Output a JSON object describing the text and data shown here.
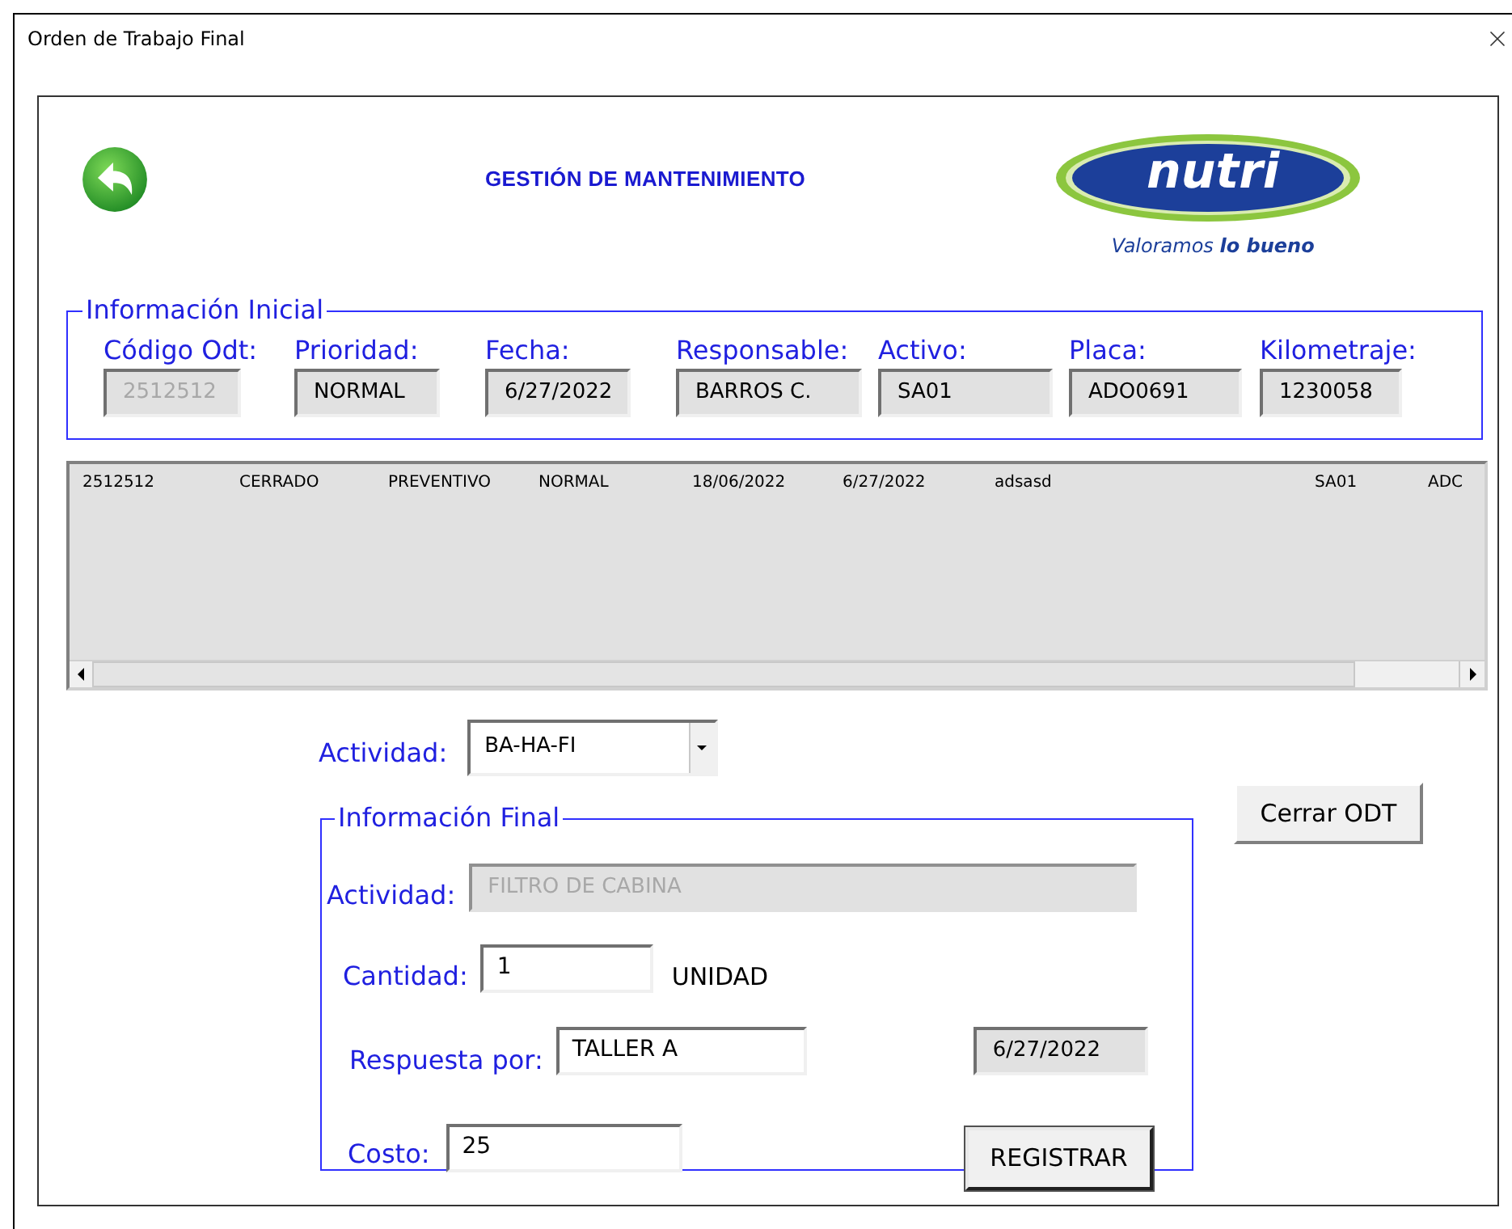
{
  "window": {
    "title": "Orden de Trabajo Final"
  },
  "header": {
    "title": "GESTIÓN DE MANTENIMIENTO",
    "logo": {
      "brand": "nutri",
      "tagline": "Valoramos **lo bueno**"
    }
  },
  "initial_info": {
    "title": "Información Inicial",
    "fields": [
      {
        "label": "Código Odt:",
        "value": "2512512",
        "disabled": true
      },
      {
        "label": "Prioridad:",
        "value": "NORMAL",
        "disabled": false
      },
      {
        "label": "Fecha:",
        "value": "6/27/2022",
        "disabled": false
      },
      {
        "label": "Responsable:",
        "value": "BARROS C.",
        "disabled": false
      },
      {
        "label": "Activo:",
        "value": "SA01",
        "disabled": false
      },
      {
        "label": "Placa:",
        "value": "ADO0691",
        "disabled": false
      },
      {
        "label": "Kilometraje:",
        "value": "1230058",
        "disabled": false
      }
    ]
  },
  "orders_list": {
    "rows": [
      [
        "2512512",
        "CERRADO",
        "PREVENTIVO",
        "NORMAL",
        "18/06/2022",
        "6/27/2022",
        "adsasd",
        "SA01",
        "ADC"
      ]
    ]
  },
  "activity": {
    "label": "Actividad:",
    "value": "BA-HA-FI"
  },
  "close_button": "Cerrar ODT",
  "final_info": {
    "title": "Información Final",
    "activity": {
      "label": "Actividad:",
      "value": "FILTRO DE CABINA",
      "disabled": true
    },
    "quantity": {
      "label": "Cantidad:",
      "value": "1",
      "unit": "UNIDAD"
    },
    "response": {
      "label": "Respuesta por:",
      "value": "TALLER A",
      "date": "6/27/2022"
    },
    "cost": {
      "label": "Costo:",
      "value": "25"
    },
    "register_button": "REGISTRAR"
  }
}
